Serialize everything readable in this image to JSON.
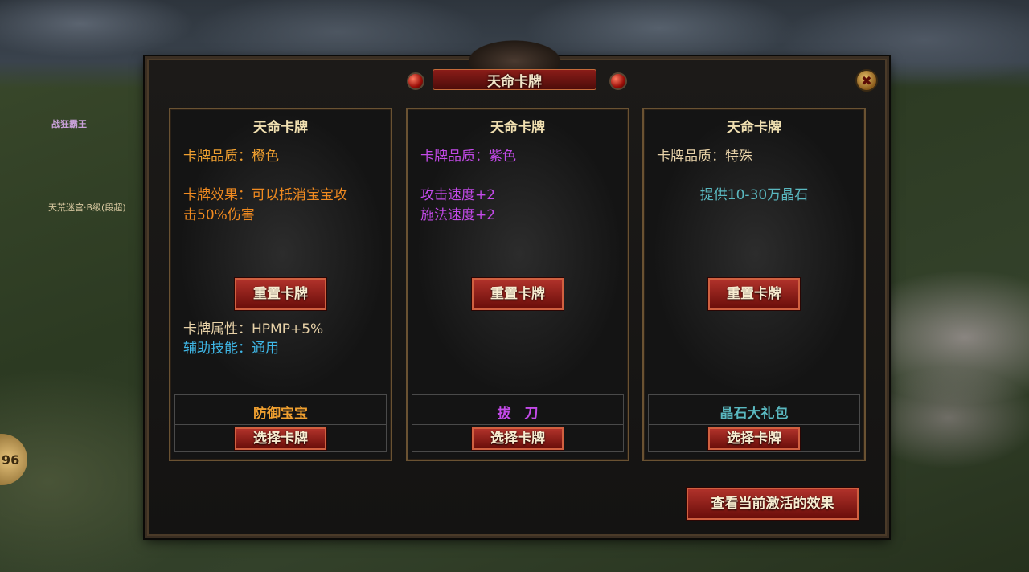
{
  "dialog": {
    "title": "天命卡牌",
    "close_glyph": "✖"
  },
  "hud": {
    "level": "96",
    "char_name": "战狂霸王",
    "guild": "天荒迷宫·B级(段超)"
  },
  "cards": [
    {
      "title": "天命卡牌",
      "quality": "卡牌品质：橙色",
      "effect_line1": "卡牌效果：可以抵消宝宝攻",
      "effect_line2": "击50%伤害",
      "reset_label": "重置卡牌",
      "attr": "卡牌属性：HPMP+5%",
      "skill": "辅助技能：通用",
      "footer_name": "防御宝宝",
      "select_label": "选择卡牌"
    },
    {
      "title": "天命卡牌",
      "quality": "卡牌品质：紫色",
      "effect_line1": "攻击速度+2",
      "effect_line2": "施法速度+2",
      "reset_label": "重置卡牌",
      "footer_name": "拔　刀",
      "select_label": "选择卡牌"
    },
    {
      "title": "天命卡牌",
      "quality": "卡牌品质：特殊",
      "effect_line1": "提供10-30万晶石",
      "reset_label": "重置卡牌",
      "footer_name": "晶石大礼包",
      "select_label": "选择卡牌"
    }
  ],
  "bottom_button": "查看当前激活的效果",
  "colors": {
    "orange": "#f0a030",
    "purple": "#c34ae8",
    "teal": "#5ab8c0",
    "cyan": "#3fb8e8",
    "gold": "#f0dfb0"
  }
}
